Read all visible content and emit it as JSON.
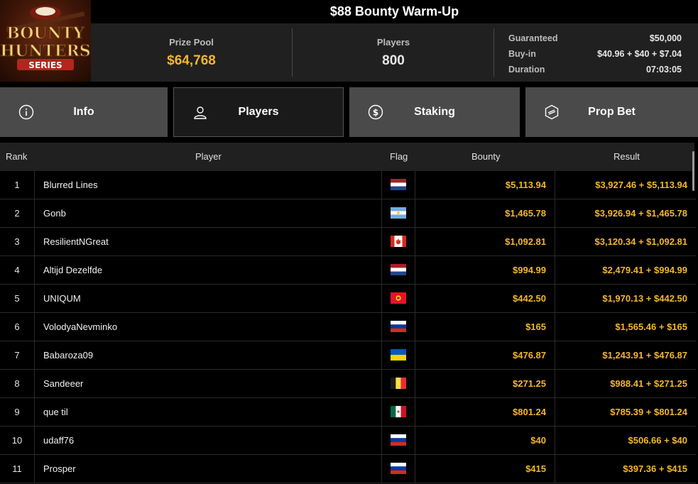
{
  "logo": {
    "line1": "BOUNTY",
    "line2": "HUNTERS",
    "line3": "SERIES"
  },
  "title": "$88 Bounty Warm-Up",
  "stats": {
    "prize_pool_label": "Prize Pool",
    "prize_pool_value": "$64,768",
    "players_label": "Players",
    "players_value": "800",
    "guaranteed_label": "Guaranteed",
    "guaranteed_value": "$50,000",
    "buyin_label": "Buy-in",
    "buyin_value": "$40.96 + $40 + $7.04",
    "duration_label": "Duration",
    "duration_value": "07:03:05"
  },
  "tabs": [
    {
      "label": "Info",
      "icon": "info-icon"
    },
    {
      "label": "Players",
      "icon": "user-icon",
      "active": true
    },
    {
      "label": "Staking",
      "icon": "dollar-coin-icon"
    },
    {
      "label": "Prop Bet",
      "icon": "prop-bet-icon"
    }
  ],
  "table": {
    "headers": {
      "rank": "Rank",
      "player": "Player",
      "flag": "Flag",
      "bounty": "Bounty",
      "result": "Result"
    },
    "rows": [
      {
        "rank": "1",
        "player": "Blurred Lines",
        "flag": "netherlands",
        "bounty": "$5,113.94",
        "result": "$3,927.46 + $5,113.94"
      },
      {
        "rank": "2",
        "player": "Gonb",
        "flag": "argentina",
        "bounty": "$1,465.78",
        "result": "$3,926.94 + $1,465.78"
      },
      {
        "rank": "3",
        "player": "ResilientNGreat",
        "flag": "canada",
        "bounty": "$1,092.81",
        "result": "$3,120.34 + $1,092.81"
      },
      {
        "rank": "4",
        "player": "Altijd Dezelfde",
        "flag": "netherlands",
        "bounty": "$994.99",
        "result": "$2,479.41 + $994.99"
      },
      {
        "rank": "5",
        "player": "UNIQUM",
        "flag": "kyrgyzstan",
        "bounty": "$442.50",
        "result": "$1,970.13 + $442.50"
      },
      {
        "rank": "6",
        "player": "VolodyaNevminko",
        "flag": "russia",
        "bounty": "$165",
        "result": "$1,565.46 + $165"
      },
      {
        "rank": "7",
        "player": "Babaroza09",
        "flag": "ukraine",
        "bounty": "$476.87",
        "result": "$1,243.91 + $476.87"
      },
      {
        "rank": "8",
        "player": "Sandeeer",
        "flag": "belgium",
        "bounty": "$271.25",
        "result": "$988.41 + $271.25"
      },
      {
        "rank": "9",
        "player": "que til",
        "flag": "mexico",
        "bounty": "$801.24",
        "result": "$785.39 + $801.24"
      },
      {
        "rank": "10",
        "player": "udaff76",
        "flag": "russia",
        "bounty": "$40",
        "result": "$506.66 + $40"
      },
      {
        "rank": "11",
        "player": "Prosper",
        "flag": "russia",
        "bounty": "$415",
        "result": "$397.36 + $415"
      }
    ]
  },
  "colors": {
    "accent": "#f5b62c",
    "tab_bg": "#4a4a4a",
    "tab_active_bg": "#1a1a1a",
    "header_bg": "#202020"
  }
}
